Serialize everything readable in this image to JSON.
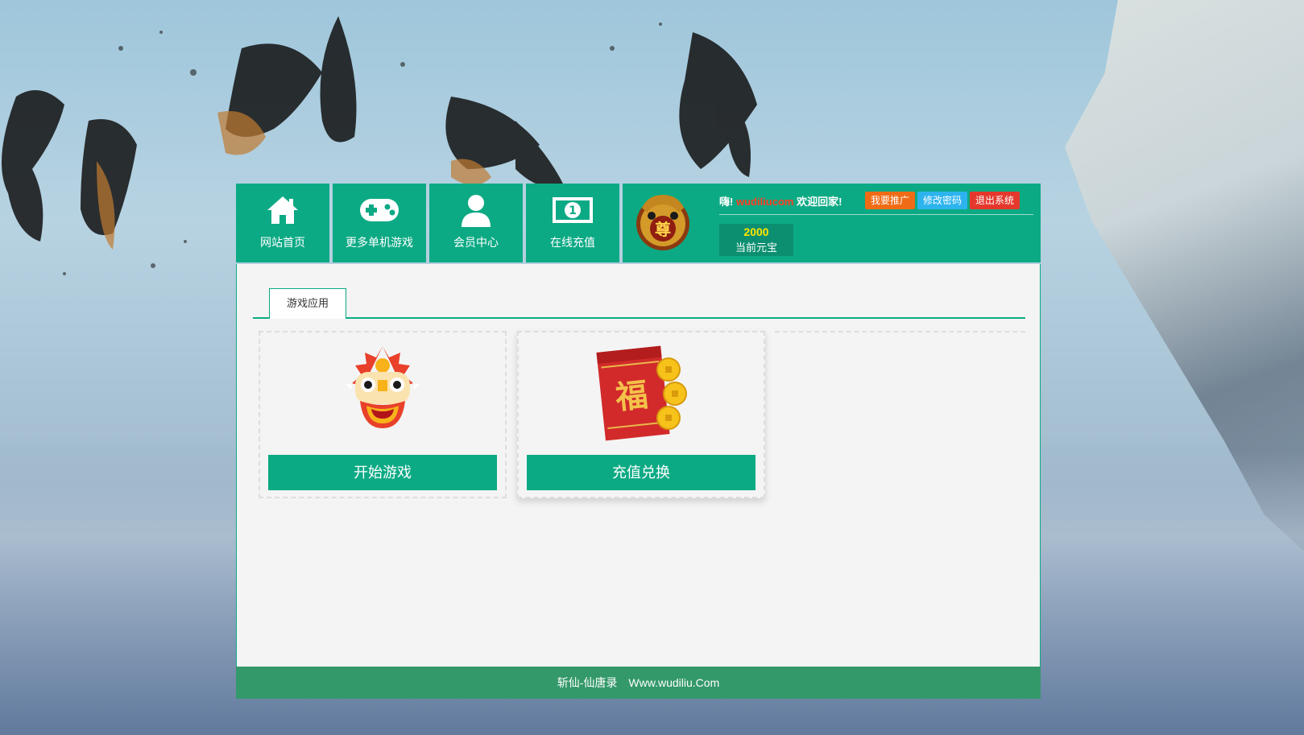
{
  "nav": {
    "items": [
      {
        "label": "网站首页",
        "icon": "home-icon"
      },
      {
        "label": "更多单机游戏",
        "icon": "gamepad-icon"
      },
      {
        "label": "会员中心",
        "icon": "user-icon"
      },
      {
        "label": "在线充值",
        "icon": "money-icon"
      }
    ]
  },
  "user": {
    "greeting_prefix": "嗨!",
    "username": "wudiliucom",
    "greeting_suffix": "欢迎回家!",
    "avatar_char": "尊",
    "buttons": {
      "promote": "我要推广",
      "change_password": "修改密码",
      "logout": "退出系统"
    },
    "balance": {
      "amount": "2000",
      "label": "当前元宝"
    }
  },
  "tabs": [
    {
      "label": "游戏应用"
    }
  ],
  "cards": [
    {
      "button": "开始游戏",
      "icon": "lion-dance-icon"
    },
    {
      "button": "充值兑换",
      "icon": "red-envelope-icon",
      "icon_char": "福"
    }
  ],
  "footer": {
    "text": "斩仙-仙唐录　Www.wudiliu.Com"
  },
  "colors": {
    "accent": "#0caa84",
    "footer": "#34996a",
    "promote": "#f06b16",
    "password": "#2db4ef",
    "logout": "#e5382c",
    "balance": "#ffe600"
  }
}
